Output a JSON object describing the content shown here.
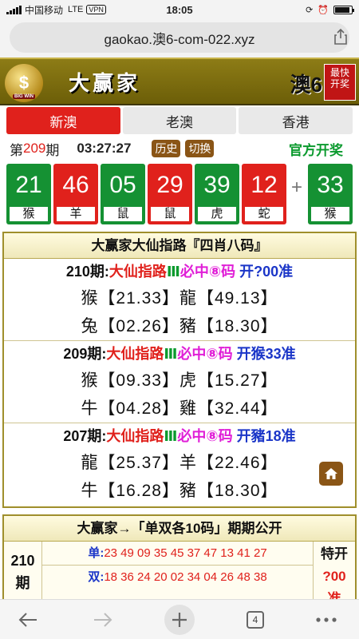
{
  "status": {
    "carrier": "中国移动",
    "network": "LTE",
    "vpn": "VPN",
    "time": "18:05",
    "battery_level": 0.9
  },
  "browser": {
    "url": "gaokao.澳6-com-022.xyz",
    "tab_count": "4"
  },
  "banner": {
    "logo_text": "$",
    "logo_caption": "BIG WIN",
    "brand": "大赢家",
    "site_name": "澳6",
    "badge_line1": "最快",
    "badge_line2": "开奖"
  },
  "tabs": [
    {
      "label": "新澳",
      "active": true
    },
    {
      "label": "老澳",
      "active": false
    },
    {
      "label": "香港",
      "active": false
    }
  ],
  "draw": {
    "prefix": "第",
    "issue": "209",
    "suffix": "期",
    "countdown": "03:27:27",
    "history_label": "历史",
    "switch_label": "切换",
    "official_label": "官方开奖",
    "plus": "+",
    "balls": [
      {
        "num": "21",
        "zodiac": "猴",
        "color": "green"
      },
      {
        "num": "46",
        "zodiac": "羊",
        "color": "red"
      },
      {
        "num": "05",
        "zodiac": "鼠",
        "color": "green"
      },
      {
        "num": "29",
        "zodiac": "鼠",
        "color": "red"
      },
      {
        "num": "39",
        "zodiac": "虎",
        "color": "green"
      },
      {
        "num": "12",
        "zodiac": "蛇",
        "color": "red"
      },
      {
        "num": "33",
        "zodiac": "猴",
        "color": "green"
      }
    ]
  },
  "predictions": {
    "title": "大赢家大仙指路『四肖八码』",
    "entries": [
      {
        "issue": "210期:",
        "tip": "大仙指路",
        "mark": "Ⅲ",
        "sure": "必中⑧码",
        "result": "开?00准",
        "line1": "猴【21.33】龍【49.13】",
        "line2": "兔【02.26】豬【18.30】"
      },
      {
        "issue": "209期:",
        "tip": "大仙指路",
        "mark": "Ⅲ",
        "sure": "必中⑧码",
        "result": "开猴33准",
        "line1": "猴【09.33】虎【15.27】",
        "line2": "牛【04.28】雞【32.44】"
      },
      {
        "issue": "207期:",
        "tip": "大仙指路",
        "mark": "Ⅲ",
        "sure": "必中⑧码",
        "result": "开豬18准",
        "line1": "龍【25.37】羊【22.46】",
        "line2": "牛【16.28】豬【18.30】"
      }
    ]
  },
  "odd_even": {
    "title": "大赢家→「单双各10码」期期公开",
    "issue_num": "210",
    "issue_unit": "期",
    "odd_label": "单:",
    "odd_values": "23 49 09 35 45 37 47 13 41 27",
    "even_label": "双:",
    "even_values": "18 36 24 20 02 34 04 26 48 38",
    "special_label": "特开",
    "special_value": "?00",
    "special_tail": "准"
  }
}
